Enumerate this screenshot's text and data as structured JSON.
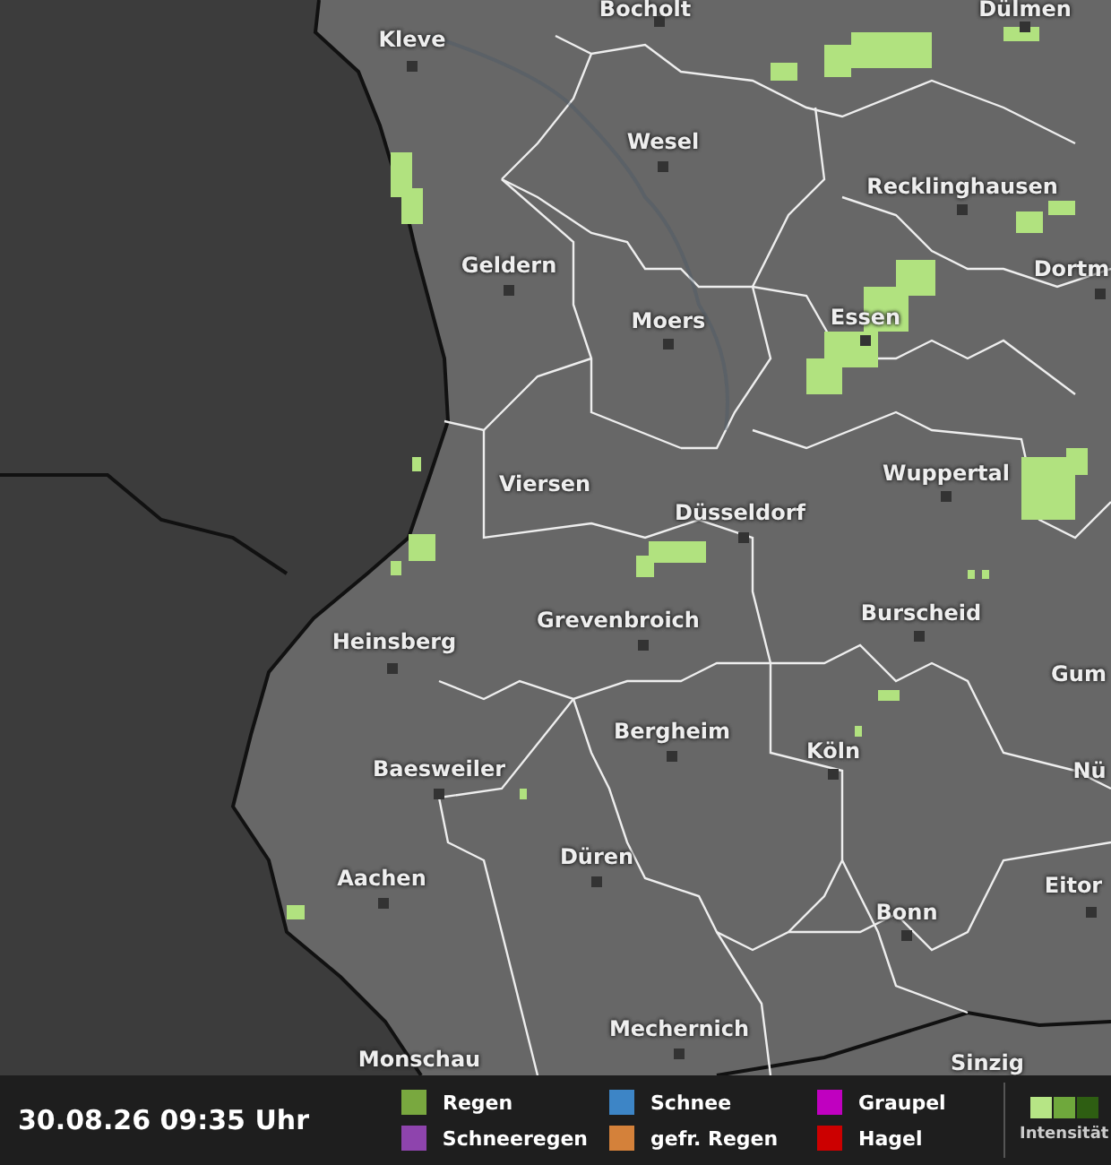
{
  "map": {
    "places": [
      {
        "name": "Bocholt"
      },
      {
        "name": "Dülmen"
      },
      {
        "name": "Kleve"
      },
      {
        "name": "Wesel"
      },
      {
        "name": "Recklinghausen"
      },
      {
        "name": "Geldern"
      },
      {
        "name": "Moers"
      },
      {
        "name": "Essen"
      },
      {
        "name": "Dortm"
      },
      {
        "name": "Viersen"
      },
      {
        "name": "Düsseldorf"
      },
      {
        "name": "Wuppertal"
      },
      {
        "name": "Heinsberg"
      },
      {
        "name": "Grevenbroich"
      },
      {
        "name": "Burscheid"
      },
      {
        "name": "Gum"
      },
      {
        "name": "Bergheim"
      },
      {
        "name": "Köln"
      },
      {
        "name": "Nü"
      },
      {
        "name": "Baesweiler"
      },
      {
        "name": "Aachen"
      },
      {
        "name": "Düren"
      },
      {
        "name": "Eitor"
      },
      {
        "name": "Bonn"
      },
      {
        "name": "Mechernich"
      },
      {
        "name": "Monschau"
      },
      {
        "name": "Sinzig"
      }
    ]
  },
  "footer": {
    "timestamp": "30.08.26 09:35 Uhr",
    "legend": [
      {
        "label": "Regen",
        "color": "#79a83f"
      },
      {
        "label": "Schneeregen",
        "color": "#8e44ad"
      },
      {
        "label": "Schnee",
        "color": "#3d85c6"
      },
      {
        "label": "gefr. Regen",
        "color": "#d4813a"
      },
      {
        "label": "Graupel",
        "color": "#c000c0"
      },
      {
        "label": "Hagel",
        "color": "#cc0000"
      }
    ],
    "intensity": {
      "label": "Intensität"
    }
  }
}
